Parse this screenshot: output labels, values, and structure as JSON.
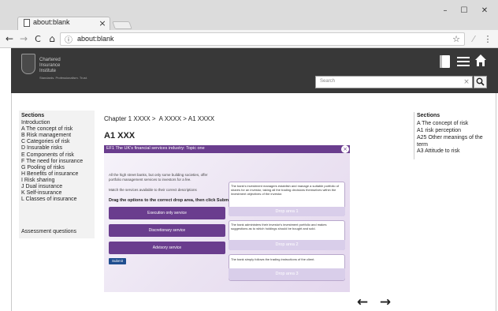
{
  "browser": {
    "tab_title": "about:blank",
    "tab_close": "×",
    "address": "about:blank",
    "win_min": "–",
    "win_max": "☐",
    "win_close": "✕",
    "back": "←",
    "forward": "→",
    "reload": "C",
    "home": "⌂",
    "info": "ⓘ",
    "star": "☆",
    "ext": "⁄",
    "menu": "⋮"
  },
  "header": {
    "logo_line1": "Chartered",
    "logo_line2": "Insurance",
    "logo_line3": "Institute",
    "logo_tagline": "Standards. Professionalism. Trust.",
    "search_placeholder": "Search",
    "search_clear": "×",
    "search_icon": "search-icon",
    "book_icon": "book-icon",
    "list_icon": "list-icon",
    "home_icon": "home-icon"
  },
  "sidebar_left": {
    "title": "Sections",
    "items": [
      "Introduction",
      "A The concept of risk",
      "B Risk management",
      "C Categories of risk",
      "D Insurable risks",
      "E Components of risk",
      "F The need for insurance",
      "G Pooling of risks",
      "H Benefits of insurance",
      "I Risk sharing",
      "J Dual insurance",
      "K Self-insurance",
      "L Classes of insurance"
    ],
    "assessment": "Assessment questions"
  },
  "main": {
    "breadcrumb": "Chapter 1 XXXX >  A XXXX > A1 XXXX",
    "title": "A1 XXX"
  },
  "activity": {
    "header": "EF1 The UK's financial services industry: Topic one",
    "close": "×",
    "intro": "All the high street banks, but only some building societies, offer portfolio management services to investors for a fee.",
    "match": "Match the services available to their correct descriptions",
    "instruction": "Drag the options to the correct drop area, then click Submit.",
    "options": [
      "Execution only service",
      "Discretionary service",
      "Advisory service"
    ],
    "submit": "Submit",
    "drops": [
      {
        "text": "The bank's investment managers establish and manage a suitable portfolio of shares for an investor, taking all the trading decisions themselves within the investment objectives of the investor.",
        "label": "Drop area 1"
      },
      {
        "text": "The bank administers their investor's investment portfolio and makes suggestions as to which holdings should be bought and sold.",
        "label": "Drop area 2"
      },
      {
        "text": "The bank simply follows the trading instructions of the client.",
        "label": "Drop area 3"
      }
    ]
  },
  "sidebar_right": {
    "title": "Sections",
    "items": [
      "A The concept of risk",
      "A1 risk perception",
      "A25 Other meanings of the term",
      "A3 Attitude to risk"
    ]
  },
  "nav": {
    "prev": "←",
    "next": "→"
  },
  "colors": {
    "header": "#383838",
    "tabbar": "#dcdcdc",
    "purple": "#6a3d8e",
    "submit": "#1f4e8f"
  }
}
